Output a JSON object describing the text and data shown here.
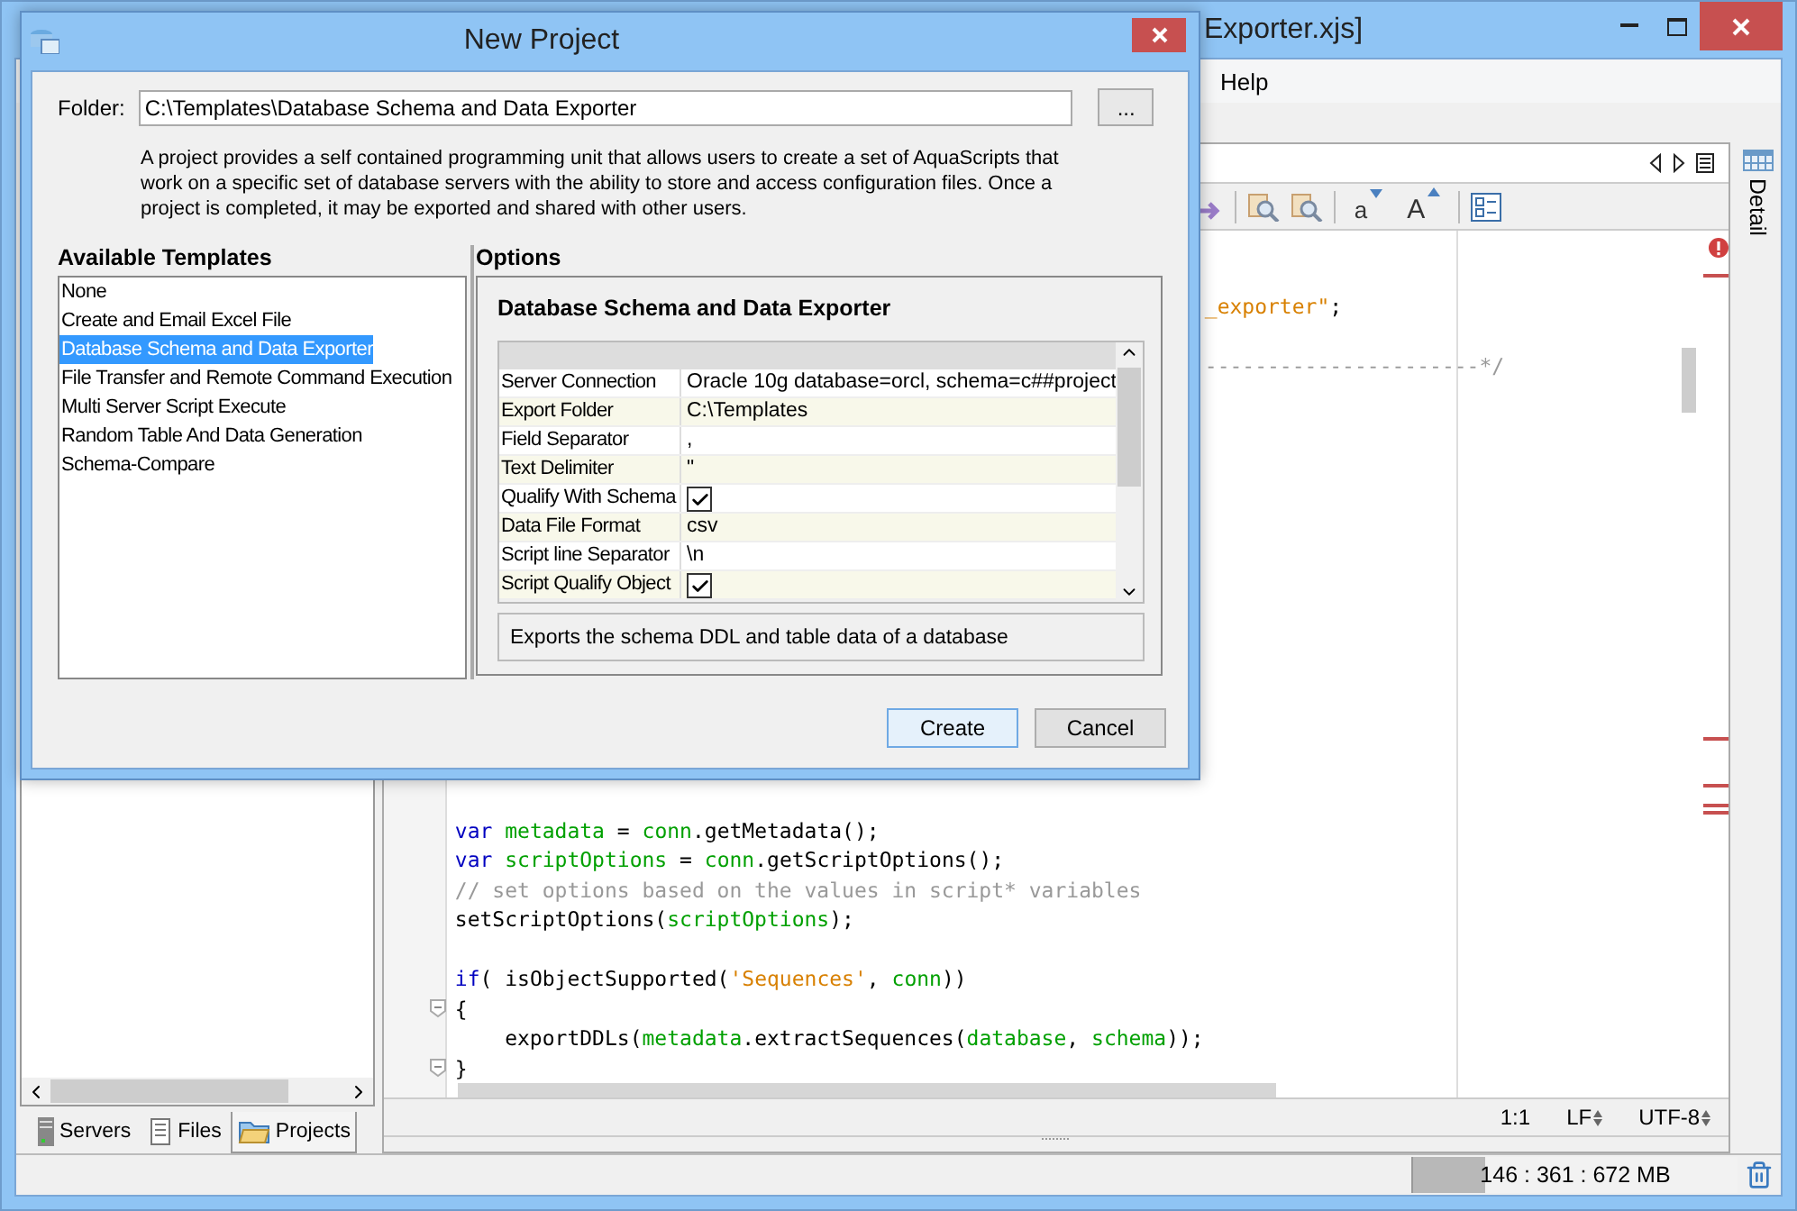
{
  "main_window": {
    "title": "Exporter.xjs]",
    "menu": [
      {
        "label": "Help"
      }
    ],
    "font_buttons": [
      {
        "label": "a",
        "kind": "smaller"
      },
      {
        "label": "A",
        "kind": "larger"
      }
    ],
    "top_lines": [
      {
        "kind": "code",
        "tokens": [
          {
            "kind": "string",
            "text": "_exporter\""
          },
          {
            "kind": "plain",
            "text": ";"
          }
        ]
      },
      {
        "kind": "blank"
      },
      {
        "kind": "code",
        "tokens": [
          {
            "kind": "comment",
            "text": "----------------------*/"
          }
        ]
      }
    ],
    "bottom_lines": [
      {
        "kind": "code",
        "fold": false,
        "tokens": [
          {
            "kind": "keyword",
            "text": "var "
          },
          {
            "kind": "variable",
            "text": "metadata"
          },
          {
            "kind": "plain",
            "text": " = "
          },
          {
            "kind": "variable",
            "text": "conn"
          },
          {
            "kind": "plain",
            "text": ".getMetadata();"
          }
        ]
      },
      {
        "kind": "code",
        "fold": false,
        "tokens": [
          {
            "kind": "keyword",
            "text": "var "
          },
          {
            "kind": "variable",
            "text": "scriptOptions"
          },
          {
            "kind": "plain",
            "text": " = "
          },
          {
            "kind": "variable",
            "text": "conn"
          },
          {
            "kind": "plain",
            "text": ".getScriptOptions();"
          }
        ]
      },
      {
        "kind": "code",
        "fold": false,
        "tokens": [
          {
            "kind": "comment",
            "text": "// set options based on the values in script* variables"
          }
        ]
      },
      {
        "kind": "code",
        "fold": false,
        "tokens": [
          {
            "kind": "plain",
            "text": "setScriptOptions("
          },
          {
            "kind": "variable",
            "text": "scriptOptions"
          },
          {
            "kind": "plain",
            "text": ");"
          }
        ]
      },
      {
        "kind": "blank",
        "fold": false
      },
      {
        "kind": "code",
        "fold": false,
        "tokens": [
          {
            "kind": "keyword",
            "text": "if"
          },
          {
            "kind": "plain",
            "text": "( isObjectSupported("
          },
          {
            "kind": "string",
            "text": "'Sequences'"
          },
          {
            "kind": "plain",
            "text": ", "
          },
          {
            "kind": "variable",
            "text": "conn"
          },
          {
            "kind": "plain",
            "text": "))"
          }
        ]
      },
      {
        "kind": "code",
        "fold": true,
        "tokens": [
          {
            "kind": "plain",
            "text": "{"
          }
        ]
      },
      {
        "kind": "code",
        "fold": false,
        "tokens": [
          {
            "kind": "plain",
            "text": "    exportDDLs("
          },
          {
            "kind": "variable",
            "text": "metadata"
          },
          {
            "kind": "plain",
            "text": ".extractSequences("
          },
          {
            "kind": "variable",
            "text": "database"
          },
          {
            "kind": "plain",
            "text": ", "
          },
          {
            "kind": "variable",
            "text": "schema"
          },
          {
            "kind": "plain",
            "text": "));"
          }
        ]
      },
      {
        "kind": "code",
        "fold": true,
        "tokens": [
          {
            "kind": "plain",
            "text": "}"
          }
        ]
      }
    ],
    "left_tabs": [
      {
        "label": "Servers",
        "kind": "server",
        "selected": false
      },
      {
        "label": "Files",
        "kind": "files",
        "selected": false
      },
      {
        "label": "Projects",
        "kind": "folder",
        "selected": true
      }
    ],
    "editor_status": {
      "position": "1:1",
      "line_ending": "LF",
      "encoding": "UTF-8"
    },
    "side_tab": "Detail",
    "memory": {
      "text": "146 : 361 : 672 MB",
      "level": 0.22
    }
  },
  "dialog": {
    "title": "New Project",
    "folder_label": "Folder:",
    "folder_value": "C:\\Templates\\Database Schema and Data Exporter",
    "browse_label": "...",
    "description": "A project provides a self contained programming unit that allows users to create a set of AquaScripts that work on a specific set of database servers with the ability to store and access configuration files.  Once a project is completed, it may be exported and shared with other users.",
    "templates_heading": "Available Templates",
    "templates": [
      {
        "label": "None",
        "selected": false
      },
      {
        "label": "Create and Email Excel File",
        "selected": false
      },
      {
        "label": "Database Schema and Data Exporter",
        "selected": true
      },
      {
        "label": "File Transfer and Remote Command Execution",
        "selected": false
      },
      {
        "label": "Multi Server Script Execute",
        "selected": false
      },
      {
        "label": "Random Table And Data Generation",
        "selected": false
      },
      {
        "label": "Schema-Compare",
        "selected": false
      }
    ],
    "options_heading": "Options",
    "options_title": "Database Schema and Data Exporter",
    "properties": [
      {
        "name": "Server Connection",
        "kind": "text",
        "value": "Oracle 10g database=orcl, schema=c##project"
      },
      {
        "name": "Export Folder",
        "kind": "text",
        "value": "C:\\Templates"
      },
      {
        "name": "Field Separator",
        "kind": "text",
        "value": ","
      },
      {
        "name": "Text Delimiter",
        "kind": "text",
        "value": "\""
      },
      {
        "name": "Qualify With Schema",
        "kind": "checkbox",
        "checked": true
      },
      {
        "name": "Data File Format",
        "kind": "text",
        "value": "csv"
      },
      {
        "name": "Script line Separator",
        "kind": "text",
        "value": "\\n"
      },
      {
        "name": "Script Qualify Object",
        "kind": "checkbox",
        "checked": true
      }
    ],
    "options_description": "Exports the schema DDL and table data of a database",
    "buttons": [
      {
        "label": "Create",
        "default": true
      },
      {
        "label": "Cancel",
        "default": false
      }
    ]
  }
}
